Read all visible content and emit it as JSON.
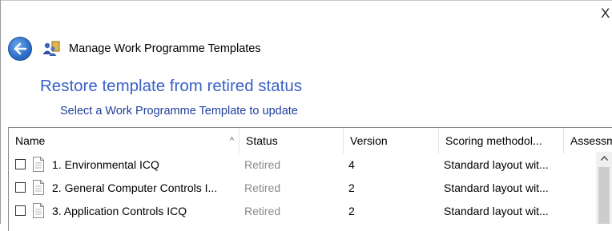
{
  "window": {
    "close_glyph": "X"
  },
  "header": {
    "title": "Manage Work Programme Templates",
    "back_icon": "back-arrow-icon",
    "app_icon": "people-shield-icon"
  },
  "page": {
    "heading": "Restore template from retired status",
    "subheading": "Select a Work Programme Template to update"
  },
  "list": {
    "columns": [
      {
        "label": "Name",
        "sorted": "ascending"
      },
      {
        "label": "Status"
      },
      {
        "label": "Version"
      },
      {
        "label": "Scoring methodol..."
      },
      {
        "label": "Assessm"
      }
    ],
    "sort_glyph": "^",
    "rows": [
      {
        "name": "1. Environmental ICQ",
        "status": "Retired",
        "version": "4",
        "scoring": "Standard layout wit...",
        "checked": false
      },
      {
        "name": "2. General Computer Controls I...",
        "status": "Retired",
        "version": "2",
        "scoring": "Standard layout wit...",
        "checked": false
      },
      {
        "name": "3. Application Controls ICQ",
        "status": "Retired",
        "version": "2",
        "scoring": "Standard layout wit...",
        "checked": false
      }
    ]
  },
  "colors": {
    "heading": "#3a61c8",
    "subheading": "#1e3f9e",
    "retired": "#8a8a8a"
  }
}
